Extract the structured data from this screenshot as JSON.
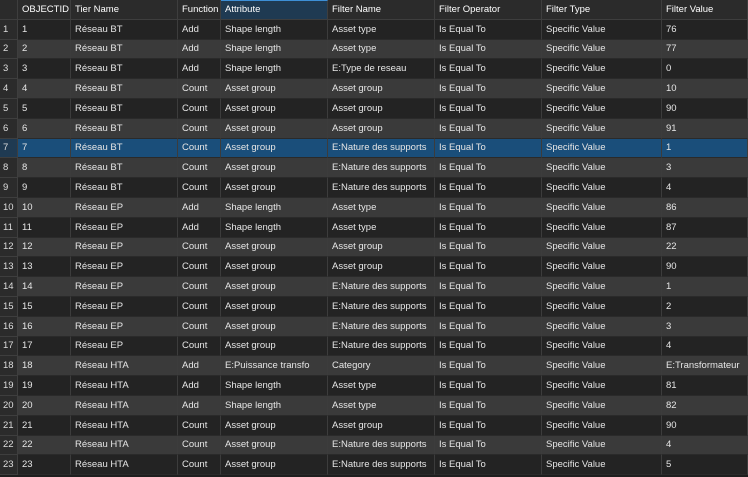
{
  "table": {
    "columns": [
      "",
      "OBJECTID *",
      "Tier Name",
      "Function",
      "Attribute",
      "Filter Name",
      "Filter Operator",
      "Filter Type",
      "Filter Value"
    ],
    "rows": [
      [
        "1",
        "1",
        "Réseau BT",
        "Add",
        "Shape length",
        "Asset type",
        "Is Equal To",
        "Specific Value",
        "76"
      ],
      [
        "2",
        "2",
        "Réseau BT",
        "Add",
        "Shape length",
        "Asset type",
        "Is Equal To",
        "Specific Value",
        "77"
      ],
      [
        "3",
        "3",
        "Réseau BT",
        "Add",
        "Shape length",
        "E:Type de reseau",
        "Is Equal To",
        "Specific Value",
        "0"
      ],
      [
        "4",
        "4",
        "Réseau BT",
        "Count",
        "Asset group",
        "Asset group",
        "Is Equal To",
        "Specific Value",
        "10"
      ],
      [
        "5",
        "5",
        "Réseau BT",
        "Count",
        "Asset group",
        "Asset group",
        "Is Equal To",
        "Specific Value",
        "90"
      ],
      [
        "6",
        "6",
        "Réseau BT",
        "Count",
        "Asset group",
        "Asset group",
        "Is Equal To",
        "Specific Value",
        "91"
      ],
      [
        "7",
        "7",
        "Réseau BT",
        "Count",
        "Asset group",
        "E:Nature des supports",
        "Is Equal To",
        "Specific Value",
        "1"
      ],
      [
        "8",
        "8",
        "Réseau BT",
        "Count",
        "Asset group",
        "E:Nature des supports",
        "Is Equal To",
        "Specific Value",
        "3"
      ],
      [
        "9",
        "9",
        "Réseau BT",
        "Count",
        "Asset group",
        "E:Nature des supports",
        "Is Equal To",
        "Specific Value",
        "4"
      ],
      [
        "10",
        "10",
        "Réseau EP",
        "Add",
        "Shape length",
        "Asset type",
        "Is Equal To",
        "Specific Value",
        "86"
      ],
      [
        "11",
        "11",
        "Réseau EP",
        "Add",
        "Shape length",
        "Asset type",
        "Is Equal To",
        "Specific Value",
        "87"
      ],
      [
        "12",
        "12",
        "Réseau EP",
        "Count",
        "Asset group",
        "Asset group",
        "Is Equal To",
        "Specific Value",
        "22"
      ],
      [
        "13",
        "13",
        "Réseau EP",
        "Count",
        "Asset group",
        "Asset group",
        "Is Equal To",
        "Specific Value",
        "90"
      ],
      [
        "14",
        "14",
        "Réseau EP",
        "Count",
        "Asset group",
        "E:Nature des supports",
        "Is Equal To",
        "Specific Value",
        "1"
      ],
      [
        "15",
        "15",
        "Réseau EP",
        "Count",
        "Asset group",
        "E:Nature des supports",
        "Is Equal To",
        "Specific Value",
        "2"
      ],
      [
        "16",
        "16",
        "Réseau EP",
        "Count",
        "Asset group",
        "E:Nature des supports",
        "Is Equal To",
        "Specific Value",
        "3"
      ],
      [
        "17",
        "17",
        "Réseau EP",
        "Count",
        "Asset group",
        "E:Nature des supports",
        "Is Equal To",
        "Specific Value",
        "4"
      ],
      [
        "18",
        "18",
        "Réseau HTA",
        "Add",
        "E:Puissance transfo",
        "Category",
        "Is Equal To",
        "Specific Value",
        "E:Transformateur"
      ],
      [
        "19",
        "19",
        "Réseau HTA",
        "Add",
        "Shape length",
        "Asset type",
        "Is Equal To",
        "Specific Value",
        "81"
      ],
      [
        "20",
        "20",
        "Réseau HTA",
        "Add",
        "Shape length",
        "Asset type",
        "Is Equal To",
        "Specific Value",
        "82"
      ],
      [
        "21",
        "21",
        "Réseau HTA",
        "Count",
        "Asset group",
        "Asset group",
        "Is Equal To",
        "Specific Value",
        "90"
      ],
      [
        "22",
        "22",
        "Réseau HTA",
        "Count",
        "Asset group",
        "E:Nature des supports",
        "Is Equal To",
        "Specific Value",
        "4"
      ],
      [
        "23",
        "23",
        "Réseau HTA",
        "Count",
        "Asset group",
        "E:Nature des supports",
        "Is Equal To",
        "Specific Value",
        "5"
      ]
    ],
    "selected_row": 7,
    "selected_column": "Attribute",
    "colors": {
      "background": "#1e1e1e",
      "row_odd": "#232323",
      "row_even": "#3a3a3a",
      "selection": "#1a4e7a",
      "header": "#2b2b2b",
      "accent": "#3d8fd6"
    }
  }
}
